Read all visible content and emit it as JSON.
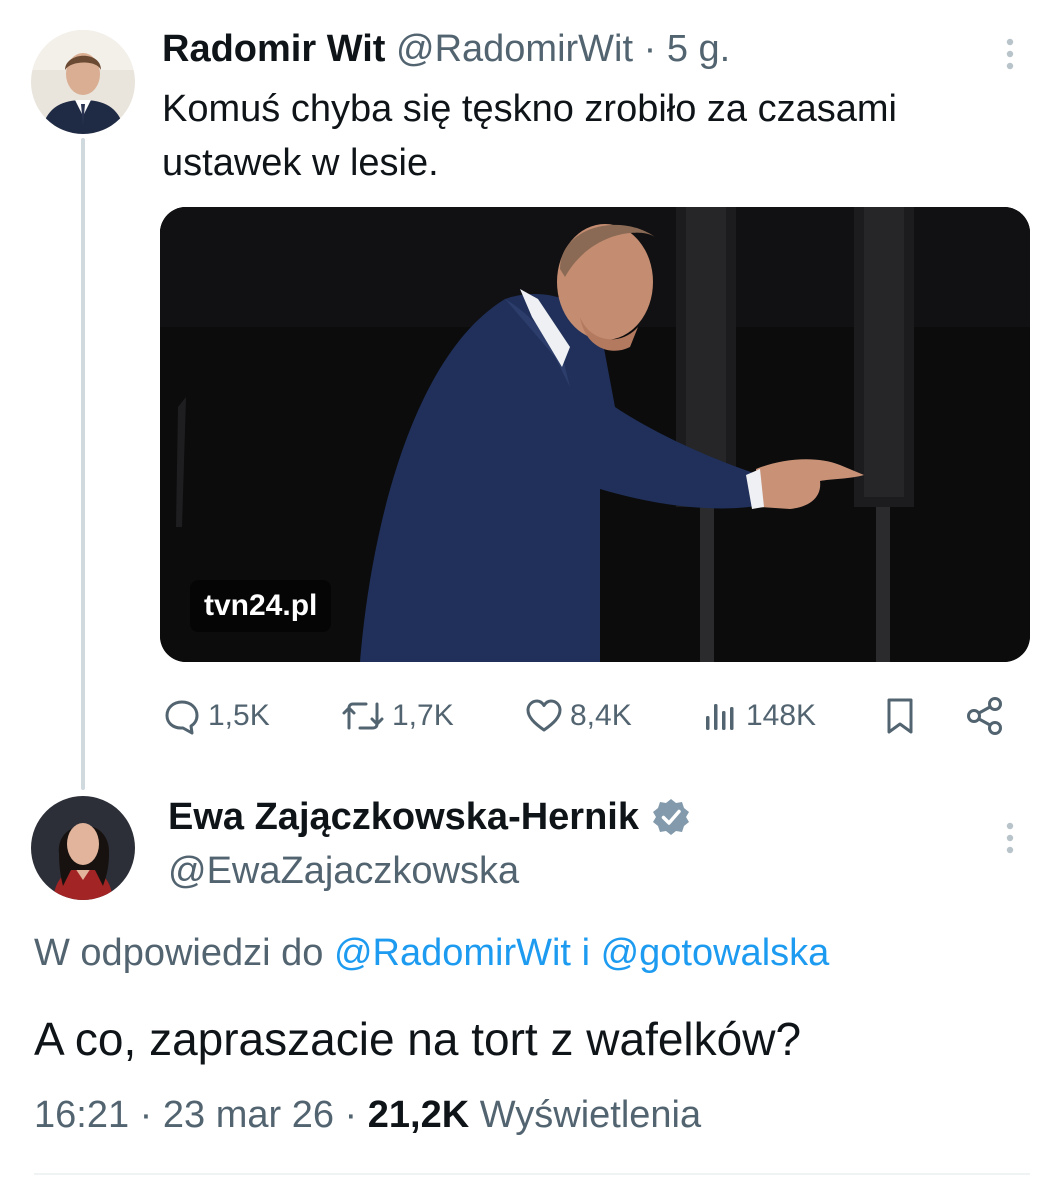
{
  "tweet": {
    "author_name": "Radomir Wit",
    "author_handle": "@RadomirWit",
    "separator": "·",
    "time_ago": "5 g.",
    "text": "Komuś chyba się tęskno zrobiło za czasami ustawek w lesie.",
    "media_watermark": "tvn24.pl",
    "stats": {
      "replies": "1,5K",
      "retweets": "1,7K",
      "likes": "8,4K",
      "views": "148K"
    }
  },
  "reply": {
    "author_name": "Ewa Zajączkowska-Hernik",
    "author_handle": "@EwaZajaczkowska",
    "verified": true,
    "reply_prefix": "W odpowiedzi do",
    "reply_user_1": "@RadomirWit",
    "reply_conj": "i",
    "reply_user_2": "@gotowalska",
    "text": "A co, zapraszacie na tort z wafelków?",
    "time": "16:21",
    "date": "23 mar 26",
    "separator": "·",
    "views_count": "21,2K",
    "views_label": "Wyświetlenia"
  },
  "colors": {
    "text": "#0f1419",
    "muted": "#536471",
    "link": "#1d9bf0",
    "thread_line": "#cfd9de",
    "verified_badge": "#829aab"
  },
  "icons": {
    "more": "more-vertical-icon",
    "reply": "reply-bubble-icon",
    "retweet": "retweet-icon",
    "like": "heart-icon",
    "views": "views-bars-icon",
    "bookmark": "bookmark-icon",
    "share": "share-icon",
    "verified": "verified-badge-icon"
  }
}
